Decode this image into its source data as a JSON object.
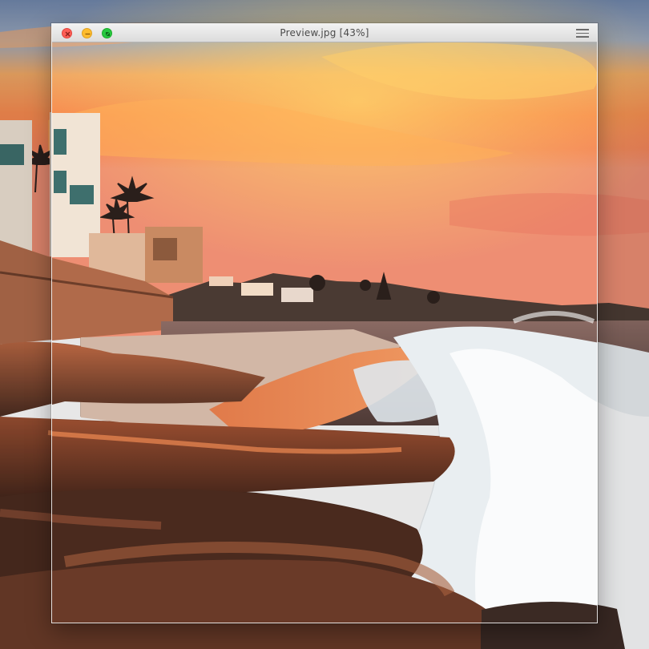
{
  "window": {
    "title": "Preview.jpg [43%]",
    "zoom_percent": 43
  },
  "traffic_lights": {
    "close_color": "#fd5f57",
    "minimize_color": "#febc2e",
    "maximize_color": "#28c840"
  },
  "icons": {
    "close": "close-icon",
    "minimize": "minimize-icon",
    "maximize": "maximize-icon",
    "menu": "hamburger-menu-icon"
  },
  "colors": {
    "sky_orange": "#f4894a",
    "sky_blue": "#8fa8c8",
    "rock_brown": "#5a3222",
    "foam_white": "#eef3f6"
  }
}
